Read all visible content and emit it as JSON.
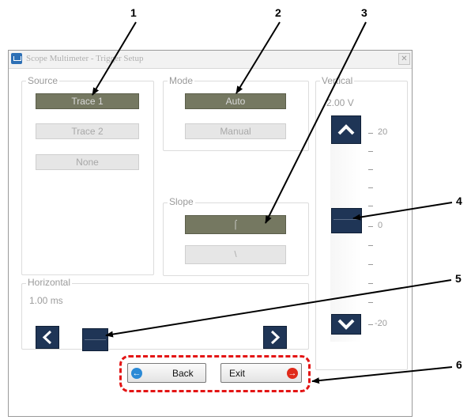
{
  "window": {
    "title": "Scope Multimeter - Trigger Setup",
    "close_glyph": "✕"
  },
  "source": {
    "label": "Source",
    "options": [
      "Trace 1",
      "Trace 2",
      "None"
    ],
    "selected": "Trace 1"
  },
  "mode": {
    "label": "Mode",
    "options": [
      "Auto",
      "Manual"
    ],
    "selected": "Auto"
  },
  "slope": {
    "label": "Slope",
    "rising_glyph": "⌠",
    "falling_glyph": "\\",
    "selected": "rising"
  },
  "horizontal": {
    "label": "Horizontal",
    "value": "1.00 ms"
  },
  "vertical": {
    "label": "Vertical",
    "value": "2.00 V",
    "scale": [
      "20",
      "0",
      "-20"
    ]
  },
  "actions": {
    "back_label": "Back",
    "exit_label": "Exit"
  },
  "callouts": [
    "1",
    "2",
    "3",
    "4",
    "5",
    "6"
  ],
  "colors": {
    "selected_button": "#757861",
    "slider_thumb": "#1f3556",
    "callout_highlight": "#e31414"
  }
}
